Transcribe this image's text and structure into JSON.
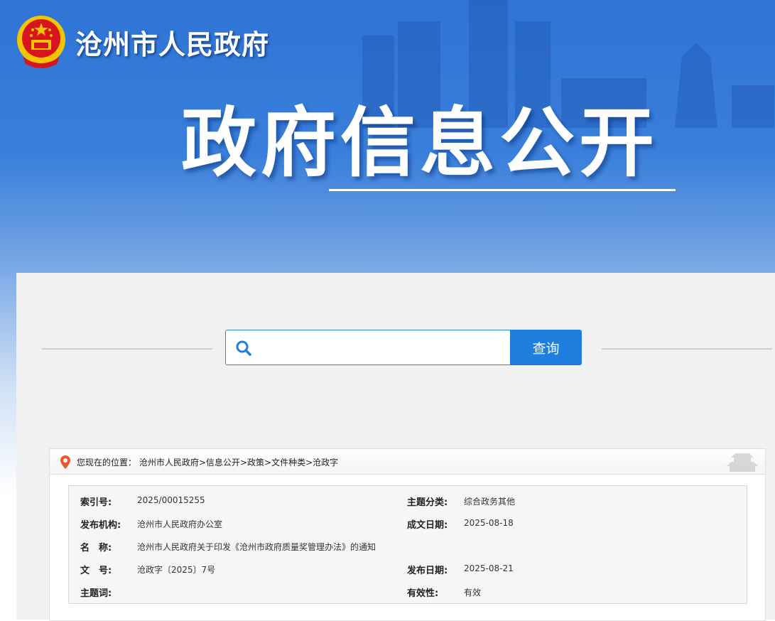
{
  "header": {
    "site_title": "沧州市人民政府",
    "page_title": "政府信息公开"
  },
  "search": {
    "placeholder": "",
    "button_label": "查询"
  },
  "breadcrumb": {
    "prefix": "您现在的位置：",
    "items": [
      "沧州市人民政府",
      "信息公开",
      "政策",
      "文件种类",
      "沧政字"
    ],
    "separator": ">"
  },
  "document_info": {
    "index_no": {
      "label": "索引号:",
      "value": "2025/00015255"
    },
    "topic": {
      "label": "主题分类:",
      "value": "综合政务其他"
    },
    "publisher": {
      "label": "发布机构:",
      "value": "沧州市人民政府办公室"
    },
    "created_date": {
      "label": "成文日期:",
      "value": "2025-08-18"
    },
    "name": {
      "label": "名　称:",
      "value": "沧州市人民政府关于印发《沧州市政府质量奖管理办法》的通知"
    },
    "doc_no": {
      "label": "文　号:",
      "value": "沧政字〔2025〕7号"
    },
    "publish_date": {
      "label": "发布日期:",
      "value": "2025-08-21"
    },
    "keywords": {
      "label": "主题词:",
      "value": ""
    },
    "validity": {
      "label": "有效性:",
      "value": "有效"
    }
  },
  "colors": {
    "accent": "#1e7fde",
    "banner": "#2f74d6",
    "emblem_red": "#d8141c",
    "emblem_gold": "#f5c400"
  }
}
